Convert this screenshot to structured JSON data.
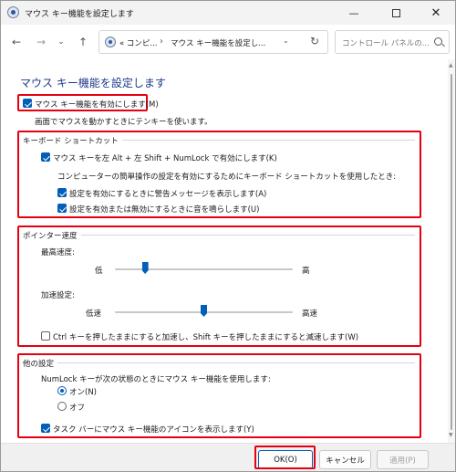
{
  "window": {
    "title": "マウス キー機能を設定します",
    "minimize_label": "—",
    "close_label": "✕"
  },
  "nav": {
    "back_label": "←",
    "forward_label": "→",
    "recent_label": "⌄",
    "up_label": "↑",
    "address_part1": "« コンピ...",
    "address_separator": "›",
    "address_part2": "マウス キー機能を設定し...",
    "address_dropdown_label": "⌄",
    "refresh_label": "↻",
    "search_placeholder": "コントロール パネルの..."
  },
  "content": {
    "page_title": "マウス キー機能を設定します",
    "enable": {
      "label": "マウス キー機能を有効にします(M)",
      "checked": true,
      "description": "画面でマウスを動かすときにテンキーを使います。"
    },
    "shortcut_group": {
      "title": "キーボード ショートカット",
      "enable_shortcut": {
        "label": "マウス キーを左 Alt + 左 Shift + NumLock で有効にします(K)",
        "checked": true
      },
      "description": "コンピューターの簡単操作の設定を有効にするためにキーボード ショートカットを使用したとき:",
      "warning": {
        "label": "設定を有効にするときに警告メッセージを表示します(A)",
        "checked": true
      },
      "sound": {
        "label": "設定を有効または無効にするときに音を鳴らします(U)",
        "checked": true
      }
    },
    "pointer_group": {
      "title": "ポインター速度",
      "top_speed_label": "最高速度:",
      "top_speed_low": "低",
      "top_speed_high": "高",
      "top_speed_value": 0.17,
      "accel_label": "加速設定:",
      "accel_low": "低速",
      "accel_high": "高速",
      "accel_value": 0.5,
      "ctrl_shift": {
        "label": "Ctrl キーを押したままにすると加速し、Shift キーを押したままにすると減速します(W)",
        "checked": false
      }
    },
    "other_group": {
      "title": "他の設定",
      "numlock_label": "NumLock キーが次の状態のときにマウス キー機能を使用します:",
      "on_label": "オン(N)",
      "off_label": "オフ",
      "selected": "on",
      "taskbar_icon": {
        "label": "タスク バーにマウス キー機能のアイコンを表示します(Y)",
        "checked": true
      }
    }
  },
  "footer": {
    "ok_label": "OK(O)",
    "cancel_label": "キャンセル",
    "apply_label": "適用(P)"
  },
  "colors": {
    "accent": "#005fb8",
    "highlight": "#e60012",
    "title": "#1e3a8a"
  }
}
